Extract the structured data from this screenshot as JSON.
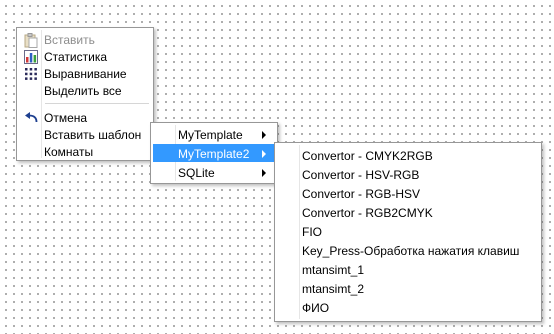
{
  "context_menu": {
    "items": [
      {
        "label": "Вставить",
        "icon": "paste-icon",
        "disabled": true
      },
      {
        "label": "Статистика",
        "icon": "statistics-icon"
      },
      {
        "label": "Выравнивание",
        "icon": "align-grid-icon"
      },
      {
        "label": "Выделить все"
      },
      {
        "label": "Отмена",
        "icon": "undo-icon"
      },
      {
        "label": "Вставить шаблон",
        "has_submenu": true
      },
      {
        "label": "Комнаты"
      }
    ]
  },
  "template_submenu": {
    "items": [
      {
        "label": "MyTemplate",
        "has_submenu": true
      },
      {
        "label": "MyTemplate2",
        "has_submenu": true,
        "highlighted": true
      },
      {
        "label": "SQLite",
        "has_submenu": true
      }
    ]
  },
  "mytemplate2_submenu": {
    "items": [
      {
        "label": "Convertor - CMYK2RGB"
      },
      {
        "label": "Convertor - HSV-RGB"
      },
      {
        "label": "Convertor - RGB-HSV"
      },
      {
        "label": "Convertor - RGB2CMYK"
      },
      {
        "label": "FIO"
      },
      {
        "label": "Key_Press-Обработка нажатия клавиш"
      },
      {
        "label": "mtansimt_1"
      },
      {
        "label": "mtansimt_2"
      },
      {
        "label": "ФИО"
      }
    ]
  },
  "colors": {
    "highlight": "#3399ff",
    "disabled_text": "#8d8d8d"
  }
}
